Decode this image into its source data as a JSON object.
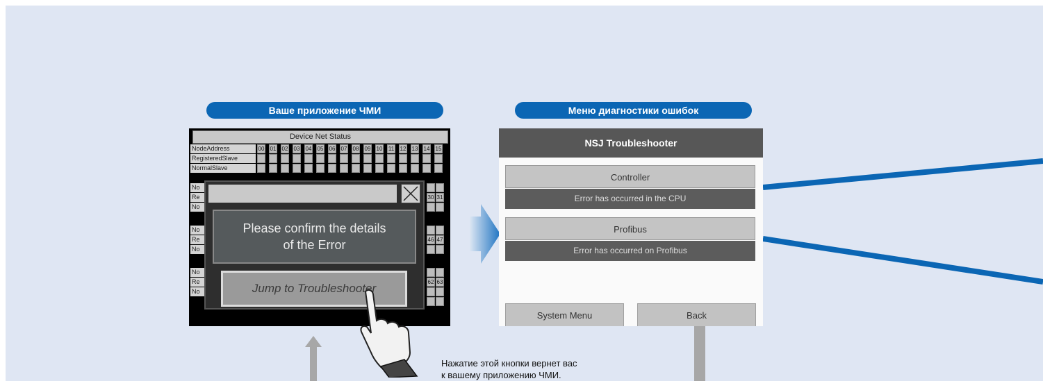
{
  "labels": {
    "hmi": "Ваше приложение ЧМИ",
    "diagnostics": "Меню диагностики ошибок"
  },
  "hmi_screen": {
    "title": "Device Net Status",
    "row_labels": [
      "NodeAddress",
      "RegisteredSlave",
      "NormalSlave",
      "No",
      "Re",
      "No",
      "No",
      "Re",
      "No",
      "No",
      "Re",
      "No"
    ],
    "node_numbers": [
      "00",
      "01",
      "02",
      "03",
      "04",
      "05",
      "06",
      "07",
      "08",
      "09",
      "10",
      "11",
      "12",
      "13",
      "14",
      "15"
    ],
    "side_numbers": [
      "30",
      "31",
      "46",
      "47",
      "62",
      "63"
    ],
    "dialog": {
      "message_line1": "Please confirm the details",
      "message_line2": "of the Error",
      "jump_button": "Jump to Troubleshooter"
    }
  },
  "troubleshooter": {
    "title": "NSJ Troubleshooter",
    "items": [
      {
        "label": "Controller",
        "error": "Error has occurred in the CPU"
      },
      {
        "label": "Profibus",
        "error": "Error has occurred on Profibus"
      }
    ],
    "system_menu_button": "System Menu",
    "back_button": "Back"
  },
  "caption": {
    "line1": "Нажатие этой кнопки вернет вас",
    "line2": "к вашему приложению ЧМИ."
  },
  "colors": {
    "background": "#dfe6f3",
    "pill": "#0b66b4",
    "connector": "#0b66b4",
    "arrow_gray": "#a7a7a7"
  }
}
